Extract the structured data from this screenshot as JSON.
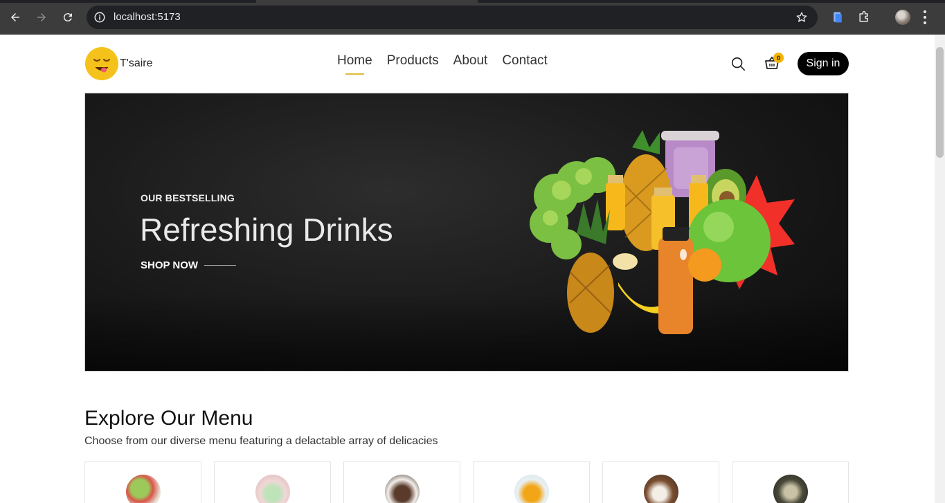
{
  "browser": {
    "url": "localhost:5173"
  },
  "site": {
    "brand": "T'saire",
    "nav": [
      {
        "label": "Home",
        "active": true
      },
      {
        "label": "Products",
        "active": false
      },
      {
        "label": "About",
        "active": false
      },
      {
        "label": "Contact",
        "active": false
      }
    ],
    "cart_count": "0",
    "signin_label": "Sign in",
    "accent_color": "#e0b93a"
  },
  "hero": {
    "kicker": "OUR BESTSELLING",
    "headline": "Refreshing Drinks",
    "cta": "SHOP NOW"
  },
  "explore": {
    "title": "Explore Our Menu",
    "subtitle": "Choose from our diverse menu featuring a delactable array of delicacies",
    "items": [
      {
        "icon": "salad-image"
      },
      {
        "icon": "smoothie-image"
      },
      {
        "icon": "chocolate-dessert-image"
      },
      {
        "icon": "juice-image"
      },
      {
        "icon": "coconut-image"
      },
      {
        "icon": "bowl-dish-image"
      }
    ]
  }
}
